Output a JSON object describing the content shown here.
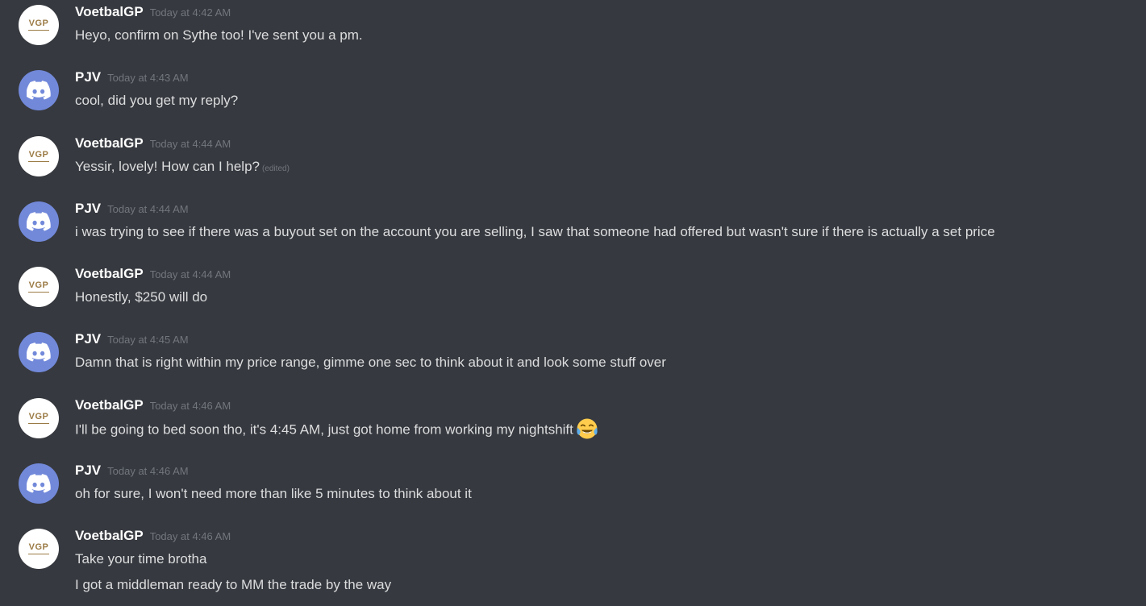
{
  "messages": [
    {
      "author": "VoetbalGP",
      "avatar_text": "VGP",
      "timestamp": "Today at 4:42 AM",
      "lines": [
        "Heyo, confirm on Sythe too! I've sent you a pm."
      ]
    },
    {
      "author": "PJV",
      "timestamp": "Today at 4:43 AM",
      "lines": [
        "cool, did you get my reply?"
      ]
    },
    {
      "author": "VoetbalGP",
      "avatar_text": "VGP",
      "timestamp": "Today at 4:44 AM",
      "lines": [
        "Yessir, lovely! How can I help?"
      ],
      "edited_label": "(edited)"
    },
    {
      "author": "PJV",
      "timestamp": "Today at 4:44 AM",
      "lines": [
        "i was trying to see if there was a buyout set on the account you are selling, I saw that someone had offered but wasn't sure if there is actually a set price"
      ]
    },
    {
      "author": "VoetbalGP",
      "avatar_text": "VGP",
      "timestamp": "Today at 4:44 AM",
      "lines": [
        "Honestly, $250 will do"
      ]
    },
    {
      "author": "PJV",
      "timestamp": "Today at 4:45 AM",
      "lines": [
        "Damn that is right within my price range, gimme one sec to think about it and look some stuff over"
      ]
    },
    {
      "author": "VoetbalGP",
      "avatar_text": "VGP",
      "timestamp": "Today at 4:46 AM",
      "lines": [
        "I'll be going to bed soon tho, it's 4:45 AM, just got home from working my nightshift"
      ],
      "emoji": "tears-of-joy-emoji"
    },
    {
      "author": "PJV",
      "timestamp": "Today at 4:46 AM",
      "lines": [
        "oh for sure, I won't need more than like 5 minutes to think about it"
      ]
    },
    {
      "author": "VoetbalGP",
      "avatar_text": "VGP",
      "timestamp": "Today at 4:46 AM",
      "lines": [
        "Take your time brotha",
        "I got a middleman ready to MM the trade by the way"
      ]
    }
  ],
  "colors": {
    "background": "#36393f",
    "username": "#ffffff",
    "timestamp": "#72767d",
    "message_text": "#dcddde",
    "discord_blurple": "#7289da",
    "vgp_gold": "#9b7b45"
  }
}
